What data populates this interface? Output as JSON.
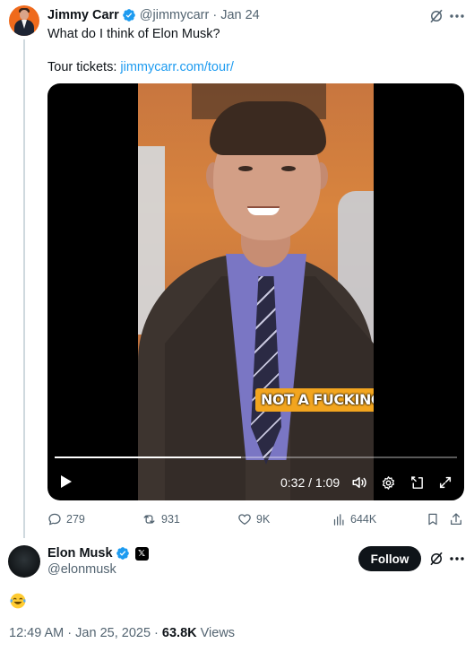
{
  "original_tweet": {
    "author_name": "Jimmy Carr",
    "handle": "@jimmycarr",
    "date_sep": "·",
    "date": "Jan 24",
    "text_line1": "What do I think of Elon Musk?",
    "tour_label": "Tour tickets: ",
    "tour_link": "jimmycarr.com/tour/",
    "video": {
      "caption": "NOT A FUCKING NAZI.",
      "current_time": "0:32",
      "time_sep": " / ",
      "duration": "1:09",
      "progress": 0.464
    },
    "stats": {
      "replies": "279",
      "reposts": "931",
      "likes": "9K",
      "views": "644K"
    }
  },
  "reply": {
    "author_name": "Elon Musk",
    "badge_text": "𝕏",
    "handle": "@elonmusk",
    "follow_label": "Follow",
    "emoji": "face-with-tears-of-joy"
  },
  "meta": {
    "time": "12:49 AM",
    "sep": " · ",
    "date": "Jan 25, 2025",
    "sep2": " · ",
    "views_count": "63.8K",
    "views_label": " Views"
  },
  "colors": {
    "accent": "#1d9bf0",
    "text": "#0f1419",
    "muted": "#536471",
    "caption_bg": "#f2a51f"
  }
}
